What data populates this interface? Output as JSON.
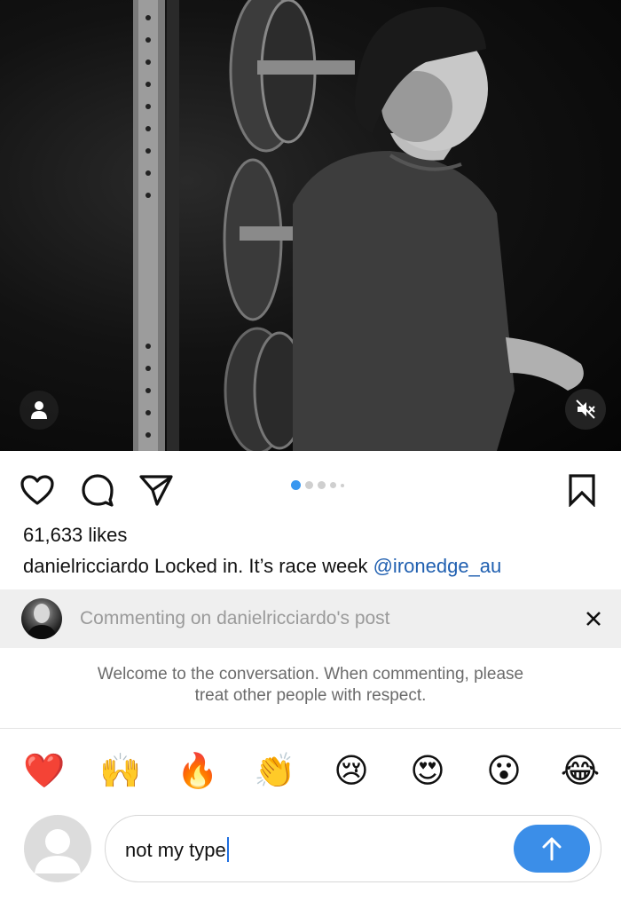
{
  "post": {
    "likes": "61,633 likes",
    "caption_user": "danielricciardo",
    "caption_text": " Locked in. It’s race week ",
    "caption_mention": "@ironedge_au",
    "carousel": {
      "count": 5,
      "active": 1
    }
  },
  "icons": {
    "tag": "person-tag-icon",
    "mute": "sound-muted-icon",
    "like": "heart-outline-icon",
    "comment": "comment-bubble-icon",
    "share": "paper-plane-icon",
    "save": "bookmark-outline-icon",
    "close": "close-x-icon",
    "send": "arrow-up-icon"
  },
  "commenting": {
    "label": "Commenting on danielricciardo's post"
  },
  "welcome": {
    "line1": "Welcome to the conversation. When commenting, please",
    "line2": "treat other people with respect."
  },
  "emojis": [
    "❤️",
    "🙌",
    "🔥",
    "👏",
    "😢",
    "😍",
    "😮",
    "😂"
  ],
  "input": {
    "value": "not my type"
  },
  "colors": {
    "accent_blue": "#3b8ee8",
    "mention_blue": "#1f5fb0",
    "carousel_active": "#3897f0"
  }
}
